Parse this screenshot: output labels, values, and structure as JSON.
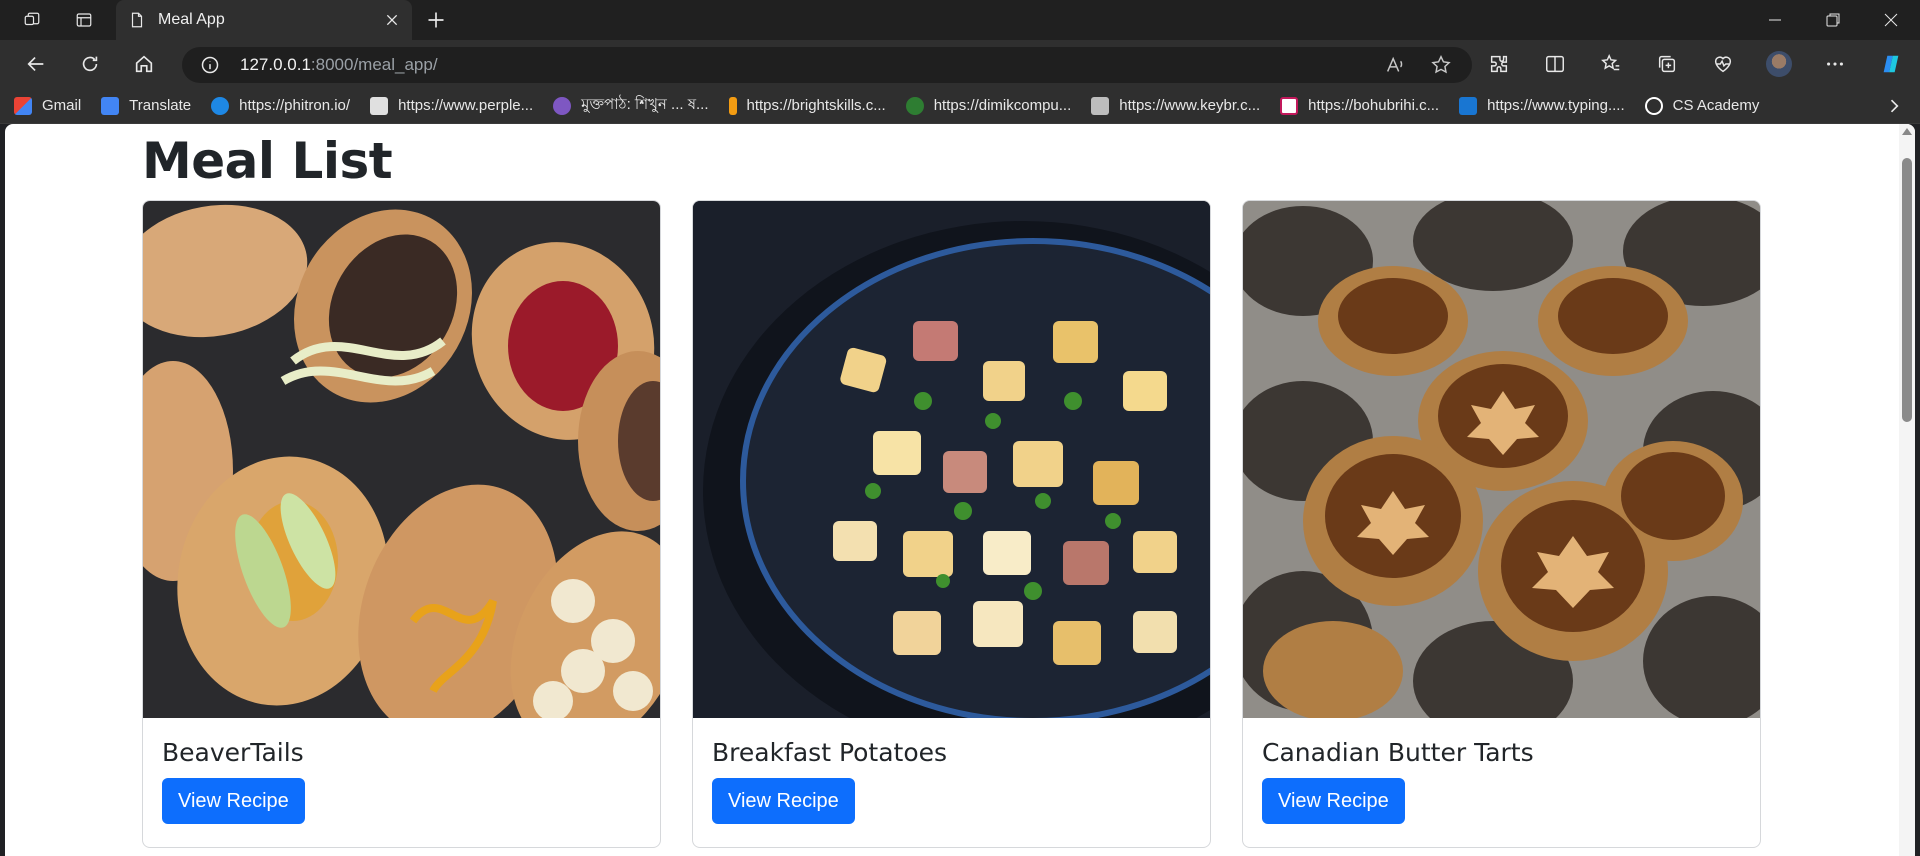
{
  "browser": {
    "tab_title": "Meal App",
    "url_host": "127.0.0.1",
    "url_rest": ":8000/meal_app/",
    "bookmarks": [
      {
        "label": "Gmail",
        "color": "#ea4335"
      },
      {
        "label": "Translate",
        "color": "#4285f4"
      },
      {
        "label": "https://phitron.io/",
        "color": "#1e88e5"
      },
      {
        "label": "https://www.perple...",
        "color": "#e0e0e0"
      },
      {
        "label": "মুক্তপাঠ: শিখুন ... ষ...",
        "color": "#7e57c2"
      },
      {
        "label": "https://brightskills.c...",
        "color": "#f39c12"
      },
      {
        "label": "https://dimikcompu...",
        "color": "#2e7d32"
      },
      {
        "label": "https://www.keybr.c...",
        "color": "#bdbdbd"
      },
      {
        "label": "https://bohubrihi.c...",
        "color": "#c2185b"
      },
      {
        "label": "https://www.typing....",
        "color": "#1976d2"
      },
      {
        "label": "CS Academy",
        "color": "#ffffff"
      }
    ]
  },
  "page": {
    "title": "Meal List",
    "button_label": "View Recipe",
    "meals": [
      {
        "name": "BeaverTails",
        "image": "beavertails-photo"
      },
      {
        "name": "Breakfast Potatoes",
        "image": "breakfast-potatoes-photo"
      },
      {
        "name": "Canadian Butter Tarts",
        "image": "butter-tarts-photo"
      }
    ]
  },
  "colors": {
    "primary_button": "#0d6efd",
    "heading": "#212529"
  }
}
